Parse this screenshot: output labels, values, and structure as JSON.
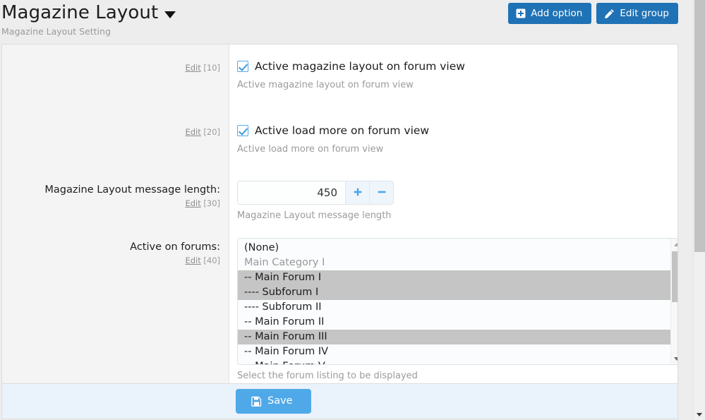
{
  "header": {
    "title": "Magazine Layout",
    "subtitle": "Magazine Layout Setting",
    "caret_icon": "chevron-down-icon",
    "buttons": [
      {
        "label": "Add option",
        "icon": "plus-square-icon"
      },
      {
        "label": "Edit group",
        "icon": "pencil-icon"
      }
    ]
  },
  "rows": [
    {
      "type": "checkbox",
      "edit_label": "Edit",
      "edit_num": "[10]",
      "checkbox_label": "Active magazine layout on forum view",
      "checked": true,
      "hint": "Active magazine layout on forum view"
    },
    {
      "type": "checkbox",
      "edit_label": "Edit",
      "edit_num": "[20]",
      "checkbox_label": "Active load more on forum view",
      "checked": true,
      "hint": "Active load more on forum view"
    },
    {
      "type": "number",
      "label": "Magazine Layout message length:",
      "edit_label": "Edit",
      "edit_num": "[30]",
      "value": "450",
      "placeholder": "",
      "increment_icon": "plus-icon",
      "decrement_icon": "minus-icon",
      "hint": "Magazine Layout message length"
    },
    {
      "type": "select",
      "label": "Active on forums:",
      "edit_label": "Edit",
      "edit_num": "[40]",
      "hint": "Select the forum listing to be displayed",
      "options": [
        {
          "label": "(None)",
          "selected": false,
          "group": false
        },
        {
          "label": "Main Category I",
          "selected": false,
          "group": true
        },
        {
          "label": "-- Main Forum I",
          "selected": true,
          "group": false
        },
        {
          "label": "---- Subforum I",
          "selected": true,
          "group": false
        },
        {
          "label": "---- Subforum II",
          "selected": false,
          "group": false
        },
        {
          "label": "-- Main Forum II",
          "selected": false,
          "group": false
        },
        {
          "label": "-- Main Forum III",
          "selected": true,
          "group": false
        },
        {
          "label": "-- Main Forum IV",
          "selected": false,
          "group": false
        },
        {
          "label": "-- Main Forum V",
          "selected": false,
          "group": false
        }
      ]
    }
  ],
  "footer": {
    "save_label": "Save",
    "save_icon": "floppy-disk-icon"
  },
  "colors": {
    "accent_blue": "#1f72b5",
    "save_blue": "#4fa9e8",
    "checkbox_blue": "#3d9ae0",
    "selected_grey": "#c5c5c5",
    "page_bg": "#ededed",
    "footer_bg": "#eaf2fb"
  }
}
